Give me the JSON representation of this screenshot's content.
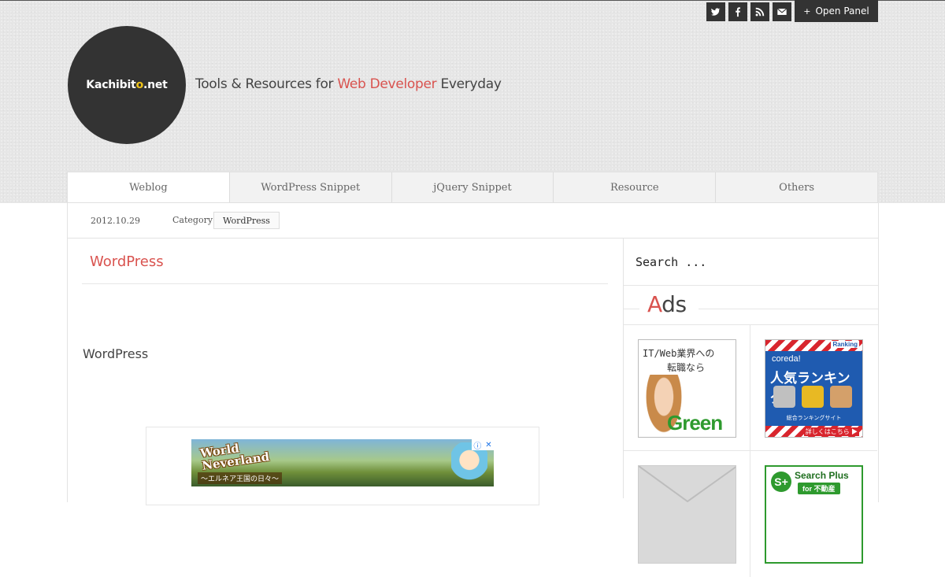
{
  "social": {
    "icons": [
      "twitter-icon",
      "facebook-icon",
      "rss-icon",
      "mail-icon"
    ]
  },
  "panel": {
    "label": "Open Panel",
    "plus": "+"
  },
  "site": {
    "logo_main": "Kachibit",
    "logo_dot_char": "o",
    "logo_end": ".net",
    "tagline_before": "Tools & Resources for ",
    "tagline_accent": "Web Developer",
    "tagline_after": " Everyday"
  },
  "nav": {
    "items": [
      "Weblog",
      "WordPress Snippet",
      "jQuery Snippet",
      "Resource",
      "Others"
    ],
    "active_index": 0
  },
  "post": {
    "date": "2012.10.29",
    "category_label": "Category:",
    "category": "WordPress",
    "title": "WordPress",
    "body": "WordPress"
  },
  "content_ad": {
    "title_line1": "World",
    "title_line2": "Neverland",
    "subtitle": "〜エルネア王国の日々〜"
  },
  "sidebar": {
    "search_placeholder": "Search ...",
    "ads_heading_first": "A",
    "ads_heading_rest": "ds"
  },
  "sidebar_ads": {
    "green": {
      "line1": "IT/Web業界への",
      "line2": "転職なら",
      "brand": "Green"
    },
    "coreda": {
      "ranking": "Ranking",
      "name": "coreda!",
      "big": "人気ランキング",
      "site": "総合ランキングサイト",
      "cta": "詳しくはこちら ▶"
    },
    "searchplus": {
      "icon_text": "S+",
      "title": "Search Plus",
      "sub": "for 不動産"
    }
  },
  "colors": {
    "accent": "#d9534f",
    "dark": "#333333",
    "logo_dot": "#f0c419",
    "green_brand": "#2e9a2e"
  }
}
